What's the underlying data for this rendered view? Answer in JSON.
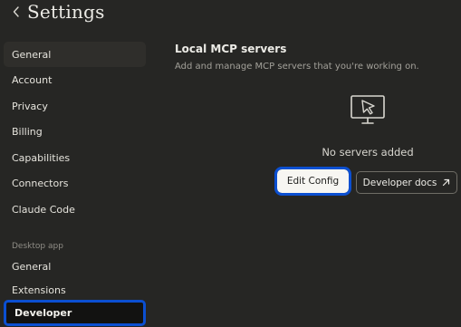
{
  "header": {
    "title": "Settings",
    "back_icon": "chevron-left-icon"
  },
  "sidebar": {
    "items": [
      {
        "label": "General"
      },
      {
        "label": "Account"
      },
      {
        "label": "Privacy"
      },
      {
        "label": "Billing"
      },
      {
        "label": "Capabilities"
      },
      {
        "label": "Connectors"
      },
      {
        "label": "Claude Code"
      }
    ],
    "desktop_section": {
      "label": "Desktop app",
      "items": [
        {
          "label": "General"
        },
        {
          "label": "Extensions"
        },
        {
          "label": "Developer",
          "active": true
        }
      ]
    }
  },
  "main": {
    "title": "Local MCP servers",
    "subtitle": "Add and manage MCP servers that you're working on.",
    "empty_icon": "monitor-cursor-icon",
    "empty_text": "No servers added",
    "edit_config_label": "Edit Config",
    "developer_docs_label": "Developer docs",
    "developer_docs_icon": "arrow-up-right-icon"
  },
  "colors": {
    "background": "#262624",
    "highlight": "#0b4fd1",
    "active_bg": "#121211"
  }
}
